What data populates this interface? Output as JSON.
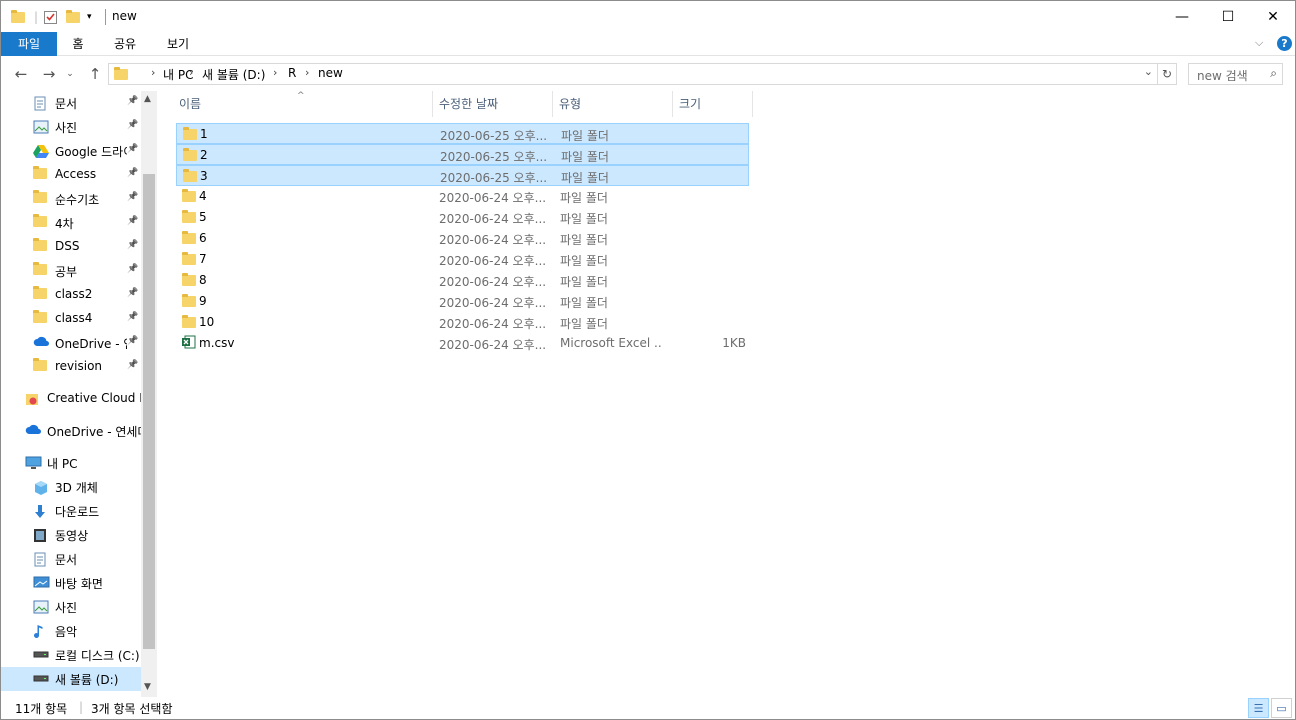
{
  "window": {
    "title": "new",
    "controls": {
      "minimize": "—",
      "maximize": "☐",
      "close": "✕"
    }
  },
  "ribbon": {
    "tabs": [
      {
        "label": "파일"
      },
      {
        "label": "홈"
      },
      {
        "label": "공유"
      },
      {
        "label": "보기"
      }
    ]
  },
  "address": {
    "breadcrumb": [
      "내 PC",
      "새 볼륨 (D:)",
      "R",
      "new"
    ],
    "search_placeholder": "new 검색"
  },
  "nav": {
    "items": [
      {
        "label": "문서",
        "icon": "document-icon",
        "pinned": true
      },
      {
        "label": "사진",
        "icon": "pictures-icon",
        "pinned": true
      },
      {
        "label": "Google 드라이브",
        "icon": "google-drive-icon",
        "pinned": true
      },
      {
        "label": "Access",
        "icon": "folder-icon",
        "pinned": true
      },
      {
        "label": "순수기초",
        "icon": "folder-icon",
        "pinned": true
      },
      {
        "label": "4차",
        "icon": "folder-icon",
        "pinned": true
      },
      {
        "label": "DSS",
        "icon": "folder-icon",
        "pinned": true
      },
      {
        "label": "공부",
        "icon": "folder-icon",
        "pinned": true
      },
      {
        "label": "class2",
        "icon": "folder-icon",
        "pinned": true
      },
      {
        "label": "class4",
        "icon": "folder-icon",
        "pinned": true
      },
      {
        "label": "OneDrive - 연",
        "icon": "onedrive-icon",
        "pinned": true
      },
      {
        "label": "revision",
        "icon": "folder-icon",
        "pinned": true
      },
      {
        "label": "Creative Cloud Files",
        "icon": "creative-cloud-icon",
        "pinned": false
      },
      {
        "label": "OneDrive - 연세대",
        "icon": "onedrive-icon",
        "pinned": false
      },
      {
        "label": "내 PC",
        "icon": "pc-icon",
        "pinned": false
      },
      {
        "label": "3D 개체",
        "icon": "3d-objects-icon",
        "pinned": false
      },
      {
        "label": "다운로드",
        "icon": "download-icon",
        "pinned": false
      },
      {
        "label": "동영상",
        "icon": "video-icon",
        "pinned": false
      },
      {
        "label": "문서",
        "icon": "document-icon",
        "pinned": false
      },
      {
        "label": "바탕 화면",
        "icon": "desktop-icon",
        "pinned": false
      },
      {
        "label": "사진",
        "icon": "pictures-icon",
        "pinned": false
      },
      {
        "label": "음악",
        "icon": "music-icon",
        "pinned": false
      },
      {
        "label": "로컬 디스크 (C:)",
        "icon": "drive-icon",
        "pinned": false
      },
      {
        "label": "새 볼륨 (D:)",
        "icon": "drive-icon",
        "pinned": false,
        "selected": true
      }
    ]
  },
  "columns": [
    "이름",
    "수정한 날짜",
    "유형",
    "크기"
  ],
  "files": [
    {
      "name": "1",
      "date": "2020-06-25 오후...",
      "type": "파일 폴더",
      "size": "",
      "icon": "folder-icon",
      "selected": true
    },
    {
      "name": "2",
      "date": "2020-06-25 오후...",
      "type": "파일 폴더",
      "size": "",
      "icon": "folder-icon",
      "selected": true
    },
    {
      "name": "3",
      "date": "2020-06-25 오후...",
      "type": "파일 폴더",
      "size": "",
      "icon": "folder-icon",
      "selected": true
    },
    {
      "name": "4",
      "date": "2020-06-24 오후...",
      "type": "파일 폴더",
      "size": "",
      "icon": "folder-icon",
      "selected": false
    },
    {
      "name": "5",
      "date": "2020-06-24 오후...",
      "type": "파일 폴더",
      "size": "",
      "icon": "folder-icon",
      "selected": false
    },
    {
      "name": "6",
      "date": "2020-06-24 오후...",
      "type": "파일 폴더",
      "size": "",
      "icon": "folder-icon",
      "selected": false
    },
    {
      "name": "7",
      "date": "2020-06-24 오후...",
      "type": "파일 폴더",
      "size": "",
      "icon": "folder-icon",
      "selected": false
    },
    {
      "name": "8",
      "date": "2020-06-24 오후...",
      "type": "파일 폴더",
      "size": "",
      "icon": "folder-icon",
      "selected": false
    },
    {
      "name": "9",
      "date": "2020-06-24 오후...",
      "type": "파일 폴더",
      "size": "",
      "icon": "folder-icon",
      "selected": false
    },
    {
      "name": "10",
      "date": "2020-06-24 오후...",
      "type": "파일 폴더",
      "size": "",
      "icon": "folder-icon",
      "selected": false
    },
    {
      "name": "m.csv",
      "date": "2020-06-24 오후...",
      "type": "Microsoft Excel ...",
      "size": "1KB",
      "icon": "excel-csv-icon",
      "selected": false
    }
  ],
  "status": {
    "item_count": "11개 항목",
    "selected_count": "3개 항목 선택함"
  },
  "colors": {
    "accent": "#1979ca",
    "selection": "#cce8ff",
    "selection_border": "#99d1ff"
  }
}
